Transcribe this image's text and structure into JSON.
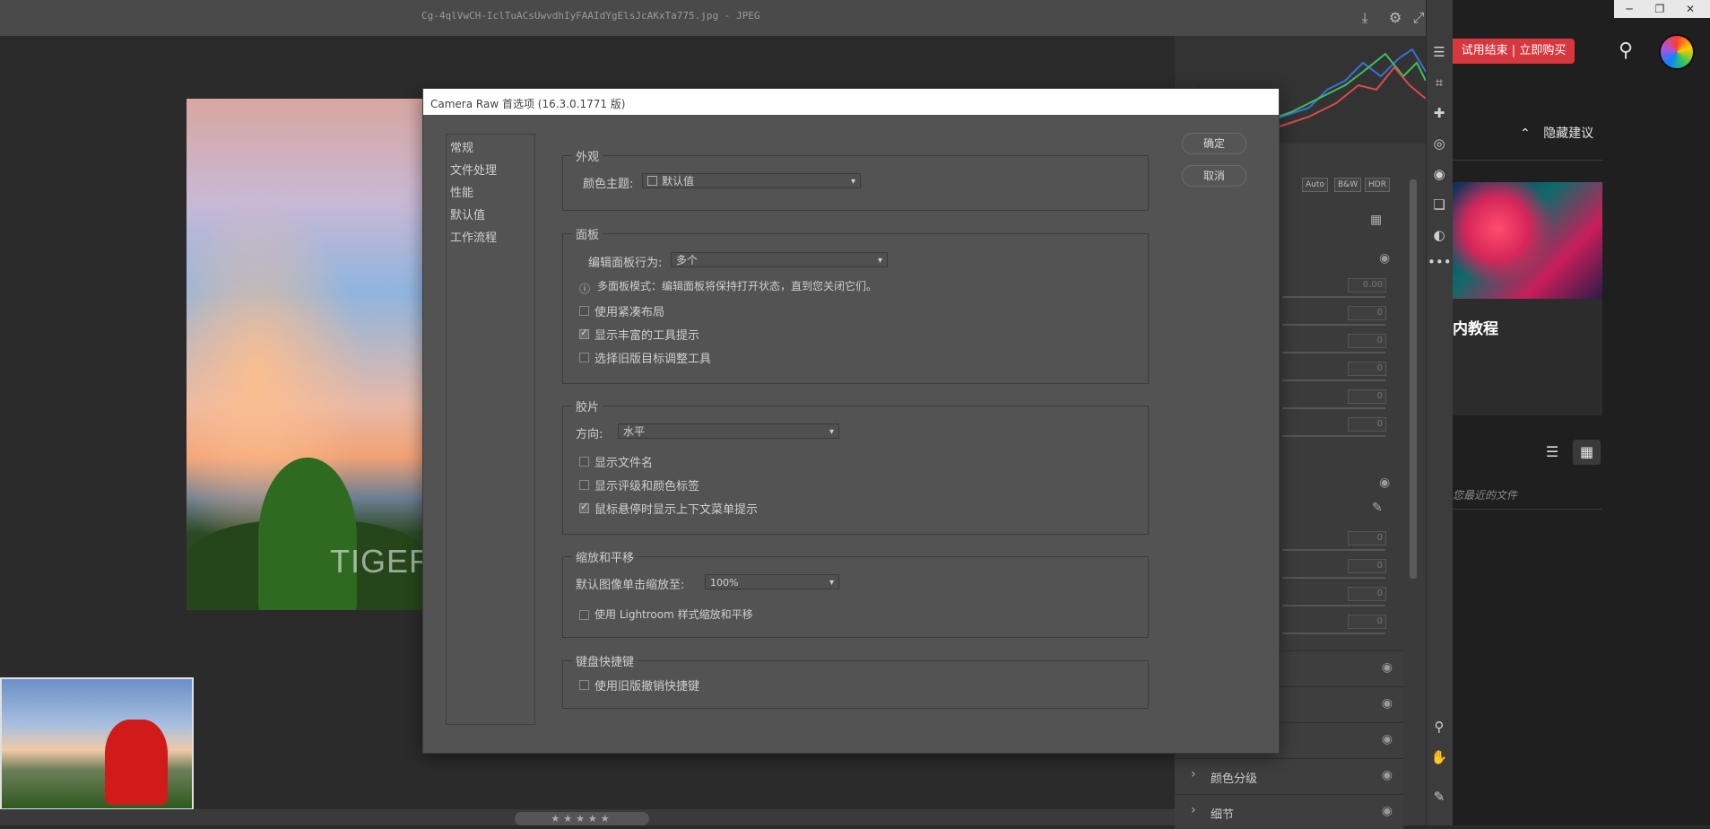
{
  "camera_raw": {
    "window_title": "Cg-4qlVwCH-IclTuACsUwvdhIyFAAIdYgElsJcAKxTa775.jpg -  JPEG",
    "image_watermark": "TIGER",
    "rating_stars": "★★★★★",
    "panel_buttons": [
      "Auto",
      "B&W",
      "HDR"
    ],
    "slider_values": [
      "0.00",
      "0",
      "0",
      "0",
      "0",
      "0",
      "0",
      "0",
      "0",
      "0"
    ],
    "sections": [
      "颜色分级",
      "细节"
    ]
  },
  "dialog": {
    "title": "Camera Raw 首选项 (16.3.0.1771 版)",
    "nav": [
      "常规",
      "文件处理",
      "性能",
      "默认值",
      "工作流程"
    ],
    "ok_label": "确定",
    "cancel_label": "取消",
    "appearance": {
      "title": "外观",
      "color_theme_label": "颜色主题:",
      "color_theme_value": "默认值"
    },
    "panels": {
      "title": "面板",
      "behavior_label": "编辑面板行为:",
      "behavior_value": "多个",
      "info": "多面板模式：编辑面板将保持打开状态，直到您关闭它们。",
      "checkboxes": [
        {
          "label": "使用紧凑布局",
          "checked": false
        },
        {
          "label": "显示丰富的工具提示",
          "checked": true
        },
        {
          "label": "选择旧版目标调整工具",
          "checked": false
        }
      ]
    },
    "filmstrip": {
      "title": "胶片",
      "direction_label": "方向:",
      "direction_value": "水平",
      "checkboxes": [
        {
          "label": "显示文件名",
          "checked": false
        },
        {
          "label": "显示评级和颜色标签",
          "checked": false
        },
        {
          "label": "鼠标悬停时显示上下文菜单提示",
          "checked": true
        }
      ]
    },
    "zoom": {
      "title": "缩放和平移",
      "default_zoom_label": "默认图像单击缩放至:",
      "default_zoom_value": "100%",
      "lightroom_label": "使用 Lightroom 样式缩放和平移",
      "lightroom_checked": false
    },
    "keyboard": {
      "title": "键盘快捷键",
      "legacy_label": "使用旧版撤销快捷键",
      "legacy_checked": false
    }
  },
  "photoshop_home": {
    "buy_label": "试用结束 | 立即购买",
    "hide_suggestions": "隐藏建议",
    "tutorial_title": "内教程",
    "recent_files": "您最近的文件"
  },
  "icons": {
    "minimize": "─",
    "restore": "❐",
    "close": "✕",
    "search": "⚲",
    "eye": "◉",
    "chevron_right": "›",
    "chevron_up": "⌃"
  }
}
